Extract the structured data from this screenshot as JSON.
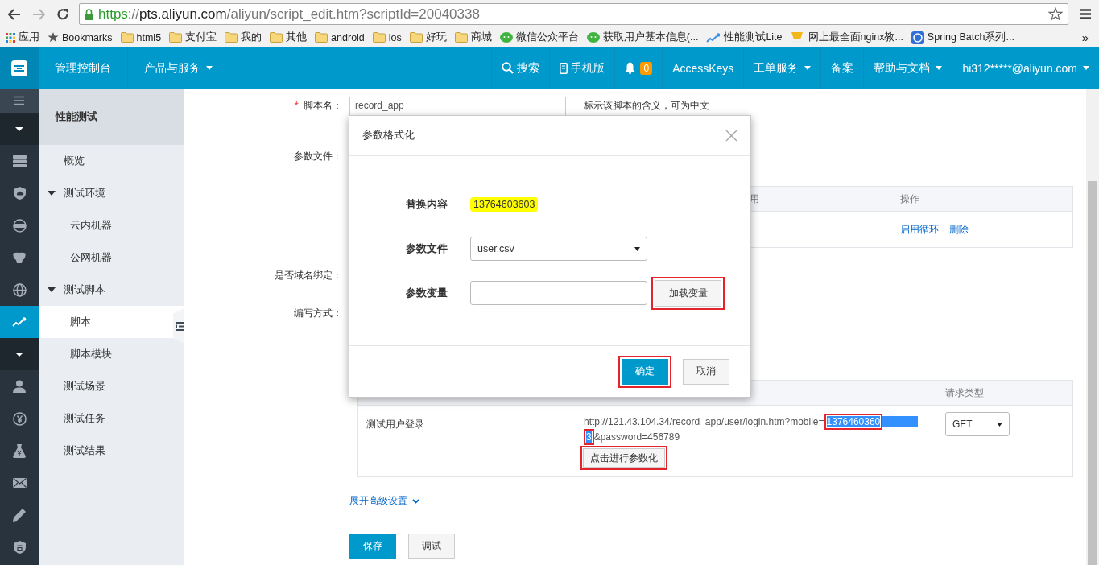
{
  "browser": {
    "url_scheme": "https",
    "url_sep": "://",
    "url_host": "pts.aliyun.com",
    "url_path": "/aliyun/script_edit.htm?scriptId=20040338",
    "forward_disabled": true,
    "bookmarks": [
      {
        "kind": "apps",
        "label": "应用"
      },
      {
        "kind": "star",
        "label": "Bookmarks"
      },
      {
        "kind": "folder",
        "label": "html5"
      },
      {
        "kind": "folder",
        "label": "支付宝"
      },
      {
        "kind": "folder",
        "label": "我的"
      },
      {
        "kind": "folder",
        "label": "其他"
      },
      {
        "kind": "folder",
        "label": "android"
      },
      {
        "kind": "folder",
        "label": "ios"
      },
      {
        "kind": "folder",
        "label": "好玩"
      },
      {
        "kind": "folder",
        "label": "商城"
      },
      {
        "kind": "chat",
        "label": "微信公众平台"
      },
      {
        "kind": "chat",
        "label": "获取用户基本信息(..."
      },
      {
        "kind": "trend",
        "label": "性能测试Lite"
      },
      {
        "kind": "cup",
        "label": "网上最全面nginx教..."
      },
      {
        "kind": "badge",
        "label": "Spring Batch系列..."
      }
    ],
    "bookmarks_overflow": "»"
  },
  "topbar": {
    "left": [
      {
        "label": "管理控制台",
        "dropdown": false
      },
      {
        "label": "产品与服务",
        "dropdown": true
      }
    ],
    "right": [
      {
        "kind": "search",
        "label": "搜索"
      },
      {
        "kind": "phone",
        "label": "手机版"
      },
      {
        "kind": "bell",
        "badge": "0"
      },
      {
        "kind": "plain",
        "label": "AccessKeys",
        "dropdown": false
      },
      {
        "kind": "plain",
        "label": "工单服务",
        "dropdown": true
      },
      {
        "kind": "plain",
        "label": "备案",
        "dropdown": false
      },
      {
        "kind": "plain",
        "label": "帮助与文档",
        "dropdown": true
      },
      {
        "kind": "plain",
        "label": "hi312*****@aliyun.com",
        "dropdown": true
      }
    ]
  },
  "rail": [
    {
      "kind": "menu",
      "selected": false
    },
    {
      "kind": "caret",
      "selected": false
    },
    {
      "kind": "server",
      "selected": false
    },
    {
      "kind": "shield",
      "selected": false
    },
    {
      "kind": "dns",
      "selected": false
    },
    {
      "kind": "mask",
      "selected": false
    },
    {
      "kind": "globe",
      "selected": false
    },
    {
      "kind": "trend",
      "selected": true
    },
    {
      "kind": "caret",
      "selected": false
    },
    {
      "kind": "user",
      "selected": false
    },
    {
      "kind": "yen",
      "selected": false
    },
    {
      "kind": "bag",
      "selected": false
    },
    {
      "kind": "mail",
      "selected": false
    },
    {
      "kind": "pencil",
      "selected": false
    },
    {
      "kind": "badge",
      "selected": false
    }
  ],
  "sidebar": {
    "title": "性能测试",
    "items": [
      {
        "label": "概览",
        "selected": false
      },
      {
        "label": "测试环境",
        "selected": false,
        "expanded": true,
        "children": [
          {
            "label": "云内机器",
            "selected": false
          },
          {
            "label": "公网机器",
            "selected": false
          }
        ]
      },
      {
        "label": "测试脚本",
        "selected": false,
        "expanded": true,
        "children": [
          {
            "label": "脚本",
            "selected": true
          },
          {
            "label": "脚本模块",
            "selected": false
          }
        ]
      },
      {
        "label": "测试场景",
        "selected": false
      },
      {
        "label": "测试任务",
        "selected": false
      },
      {
        "label": "测试结果",
        "selected": false
      }
    ]
  },
  "form": {
    "script_name": {
      "required_mark": "*",
      "label": "脚本名：",
      "value": "record_app",
      "hint": "标示该脚本的含义，可为中文"
    },
    "param_file_label": "参数文件：",
    "param_table": {
      "column_3": "用",
      "column_4": "操作",
      "actions": [
        {
          "label": "启用循环"
        },
        {
          "label": "删除"
        }
      ]
    },
    "domain_label": "是否域名绑定：",
    "mode_label": "编写方式：",
    "request_table": {
      "column_3": "请求类型",
      "rows": [
        {
          "name": "测试用户登录",
          "url_lines": [
            {
              "selection_to_end": true,
              "segments": [
                {
                  "text": "http://121.43.104.34/record_app/user/login.htm?mobile=",
                  "selected": false,
                  "highlighted": false
                },
                {
                  "text": "1376460360",
                  "selected": true,
                  "highlighted": true
                }
              ]
            },
            {
              "segments": [
                {
                  "text": "3",
                  "selected": true,
                  "highlighted": true
                },
                {
                  "text": "&password=456789",
                  "selected": false,
                  "highlighted": false
                }
              ]
            }
          ],
          "button": {
            "label": "点击进行参数化",
            "highlighted": true
          },
          "method": "GET"
        }
      ]
    },
    "advanced_link": "展开高级设置",
    "buttons": [
      {
        "label": "保存",
        "primary": true
      },
      {
        "label": "调试",
        "primary": false
      }
    ]
  },
  "dialog": {
    "title": "参数格式化",
    "replace_label": "替换内容",
    "replace_value": "13764603603",
    "file_label": "参数文件",
    "file_value": "user.csv",
    "var_label": "参数变量",
    "load_button": {
      "label": "加载变量",
      "highlighted": true
    },
    "buttons": [
      {
        "label": "确定",
        "primary": true,
        "highlighted": true
      },
      {
        "label": "取消",
        "primary": false,
        "highlighted": false
      }
    ]
  }
}
